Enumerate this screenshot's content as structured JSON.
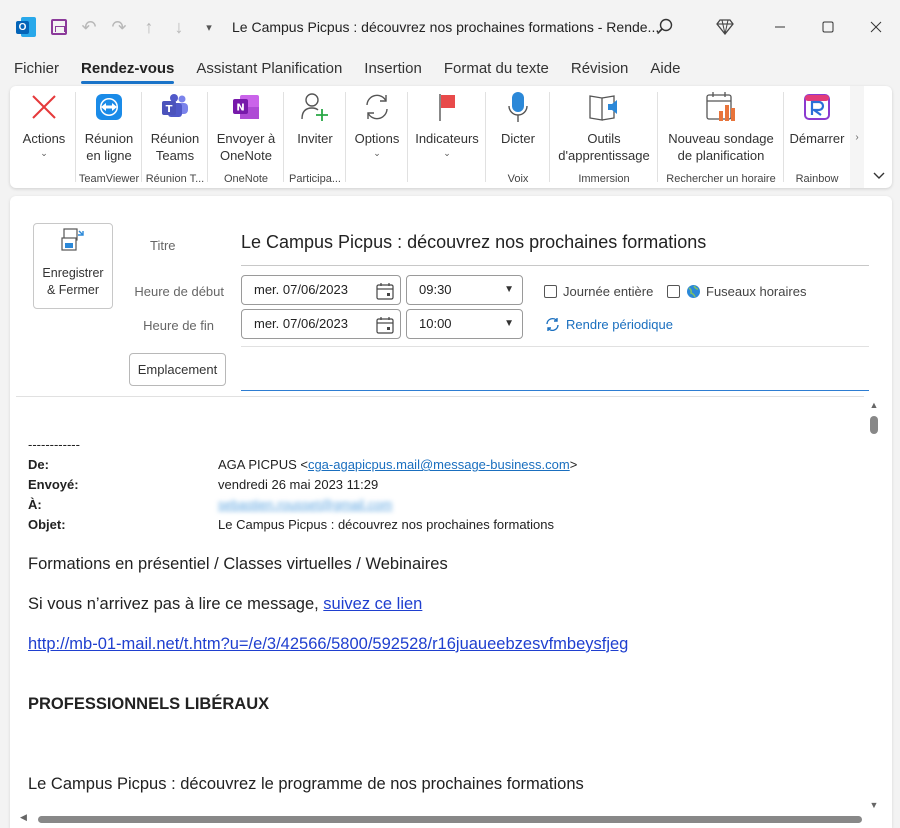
{
  "titlebar": {
    "app_icon": "outlook-icon",
    "window_title": "Le Campus Picpus : découvrez nos prochaines formations  -  Rende..."
  },
  "menu": {
    "tabs": [
      "Fichier",
      "Rendez-vous",
      "Assistant Planification",
      "Insertion",
      "Format du texte",
      "Révision",
      "Aide"
    ],
    "active": "Rendez-vous"
  },
  "ribbon": {
    "actions": {
      "label": "Actions"
    },
    "teamviewer": {
      "label1": "Réunion",
      "label2": "en ligne",
      "group": "TeamViewer"
    },
    "teams": {
      "label1": "Réunion",
      "label2": "Teams",
      "group": "Réunion T..."
    },
    "onenote": {
      "label1": "Envoyer à",
      "label2": "OneNote",
      "group": "OneNote"
    },
    "inviter": {
      "label": "Inviter",
      "group": "Participa..."
    },
    "options": {
      "label": "Options"
    },
    "indicateurs": {
      "label": "Indicateurs"
    },
    "dicter": {
      "label": "Dicter",
      "group": "Voix"
    },
    "outils": {
      "label1": "Outils",
      "label2": "d'apprentissage",
      "group": "Immersion"
    },
    "sondage": {
      "label1": "Nouveau sondage",
      "label2": "de planification",
      "group": "Rechercher un horaire"
    },
    "demarrer": {
      "label": "Démarrer",
      "group": "Rainbow"
    }
  },
  "form": {
    "save_close": {
      "line1": "Enregistrer",
      "line2": "& Fermer"
    },
    "title_label": "Titre",
    "title_value": "Le Campus Picpus : découvrez nos prochaines formations",
    "start_label": "Heure de début",
    "end_label": "Heure de fin",
    "start_date": "mer. 07/06/2023",
    "start_time": "09:30",
    "end_date": "mer. 07/06/2023",
    "end_time": "10:00",
    "all_day": "Journée entière",
    "timezones": "Fuseaux horaires",
    "recurrence": "Rendre périodique",
    "location_button": "Emplacement",
    "location_value": ""
  },
  "email": {
    "separator": "------------",
    "from_label": "De:",
    "from_name": "AGA PICPUS <",
    "from_email": "cga-agapicpus.mail@message-business.com",
    "from_end": ">",
    "sent_label": "Envoyé:",
    "sent_value": "vendredi 26 mai 2023 11:29",
    "to_label": "À:",
    "to_value": "sebastien.rousset@gmail.com",
    "subject_label": "Objet:",
    "subject_value": "Le Campus Picpus : découvrez nos prochaines formations",
    "line1": "Formations en présentiel / Classes virtuelles / Webinaires",
    "line2_text": "Si vous n’arrivez pas à lire ce message, ",
    "line2_link": "suivez ce lien",
    "url": "http://mb-01-mail.net/t.htm?u=/e/3/42566/5800/592528/r16juaueebzesvfmbeysfjeg",
    "heading": "PROFESSIONNELS LIBÉRAUX",
    "line3": "Le Campus Picpus : découvrez le programme de nos prochaines formations"
  }
}
